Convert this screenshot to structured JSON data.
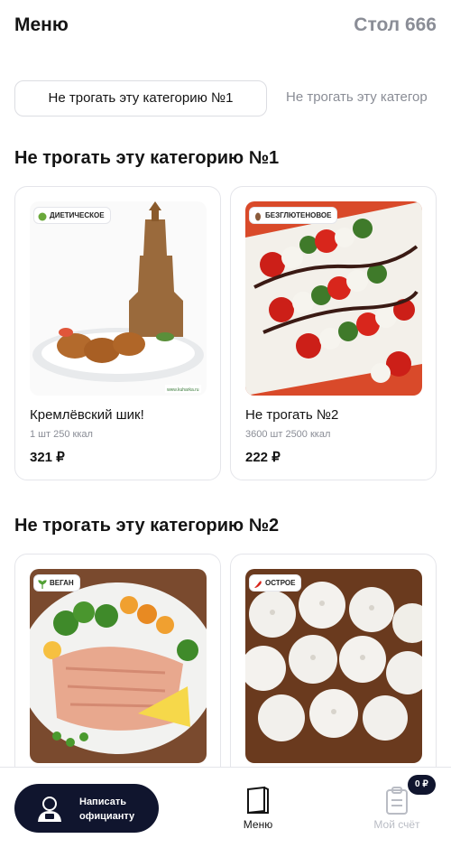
{
  "header": {
    "title": "Меню",
    "table": "Стол 666"
  },
  "tabs": [
    {
      "label": "Не трогать эту категорию №1",
      "active": true
    },
    {
      "label": "Не трогать эту категор",
      "active": false
    }
  ],
  "sections": [
    {
      "title": "Не трогать эту категорию №1",
      "items": [
        {
          "badge": "ДИЕТИЧЕСКОЕ",
          "name": "Кремлёвский шик!",
          "meta": "1 шт 250 ккал",
          "price": "321 ₽",
          "watermark": "www.kuharka.ru"
        },
        {
          "badge": "БЕЗГЛЮТЕНОВОЕ",
          "name": "Не трогать №2",
          "meta": "3600 шт 2500 ккал",
          "price": "222 ₽"
        }
      ]
    },
    {
      "title": "Не трогать эту категорию №2",
      "items": [
        {
          "badge": "ВЕГАН"
        },
        {
          "badge": "ОСТРОЕ"
        }
      ]
    }
  ],
  "bottom": {
    "call_line1": "Написать",
    "call_line2": "официанту",
    "menu": "Меню",
    "bill": "Мой счёт",
    "bill_badge": "0 ₽"
  },
  "colors": {
    "accent": "#10152e",
    "muted": "#8a8d96",
    "border": "#e4e5ea"
  }
}
